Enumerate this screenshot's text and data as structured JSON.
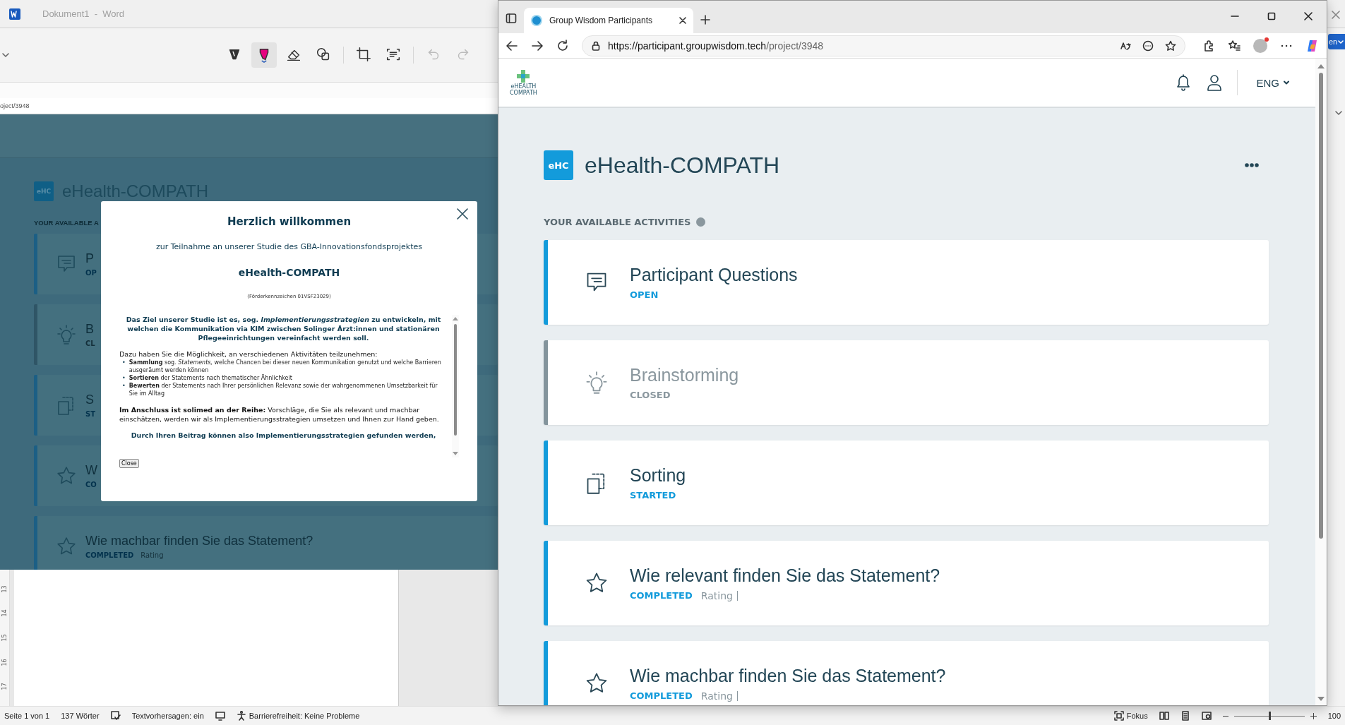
{
  "word": {
    "title": "Dokument1  -  Word",
    "tools": [
      {
        "kind": "pen",
        "selected": false,
        "disabled": false
      },
      {
        "kind": "highlighter",
        "selected": true,
        "disabled": false
      },
      {
        "kind": "eraser",
        "selected": false,
        "disabled": false
      },
      {
        "kind": "shapes",
        "selected": false,
        "disabled": false
      },
      {
        "kind": "crop",
        "selected": false,
        "disabled": false
      },
      {
        "kind": "scan",
        "selected": false,
        "disabled": false
      },
      {
        "kind": "undo",
        "selected": false,
        "disabled": true
      },
      {
        "kind": "redo",
        "selected": false,
        "disabled": true
      }
    ],
    "url_fragment": "oject/3948",
    "ruler": [
      "13",
      "14",
      "15",
      "16",
      "17"
    ]
  },
  "embedded_page": {
    "badge": "eHC",
    "title": "eHealth-COMPATH",
    "section": "YOUR AVAILABLE A",
    "cards": [
      {
        "kind": "questions",
        "title": "P",
        "status": "OP",
        "closed": false
      },
      {
        "kind": "idea",
        "title": "B",
        "status": "CL",
        "closed": true
      },
      {
        "kind": "sorting",
        "title": "S",
        "status": "ST",
        "closed": false
      },
      {
        "kind": "rating",
        "title": "W",
        "status": "CO",
        "closed": false
      },
      {
        "kind": "rating",
        "title": "Wie machbar finden Sie das Statement?",
        "status": "COMPLETED",
        "extra": "Rating",
        "closed": false
      }
    ]
  },
  "dialog": {
    "title": "Herzlich willkommen",
    "subtitle": "zur Teilnahme an unserer Studie des GBA-Innovationsfondsprojektes",
    "project": "eHealth-COMPATH",
    "grant": "(Förderkennzeichen 01VSF23029)",
    "goal": "Das Ziel unserer Studie ist es, sog. *Implementierungsstrategien* zu entwickeln, mit welchen die Kommunikation via KIM zwischen Solinger Ärzt:innen und stationären Pflegeeinrichtungen vereinfacht werden soll.",
    "intro": "Dazu haben Sie die Möglichkeit, an verschiedenen Aktivitäten teilzunehmen:",
    "bullet": "•",
    "activities": [
      "**Sammlung** sog. *Statements,* welche Chancen bei dieser neuen Kommunikation genutzt und welche Barrieren ausgeräumt werden können",
      "**Sortieren** der Statements nach thematischer Ähnlichkeit",
      "**Bewerten** der Statements nach Ihrer persönlichen Relevanz sowie der wahrgenommenen Umsetzbarkeit für Sie im Alltag"
    ],
    "next": "**Im Anschluss ist solimed an der Reihe:** Vorschläge, die Sie als relevant und machbar einschätzen, werden wir als Implementierungsstrategien umsetzen und Ihnen zur Hand geben.",
    "closing": "Durch Ihren Beitrag können also Implementierungsstrategien gefunden werden,",
    "close_button": "Close"
  },
  "browser": {
    "tab_title": "Group Wisdom Participants",
    "url_host": "https://participant.groupwisdom.tech",
    "url_path": "/project/3948",
    "logo_lines": [
      "eHEALTH",
      "COMPATH"
    ],
    "language": "ENG",
    "project_badge": "eHC",
    "project_title": "eHealth-COMPATH",
    "section": "YOUR AVAILABLE ACTIVITIES",
    "activities": [
      {
        "kind": "questions",
        "title": "Participant Questions",
        "status": "OPEN",
        "closed": false
      },
      {
        "kind": "idea",
        "title": "Brainstorming",
        "status": "CLOSED",
        "closed": true
      },
      {
        "kind": "sorting",
        "title": "Sorting",
        "status": "STARTED",
        "closed": false
      },
      {
        "kind": "rating",
        "title": "Wie relevant finden Sie das Statement?",
        "status": "COMPLETED",
        "extra": "Rating",
        "closed": false
      },
      {
        "kind": "rating",
        "title": "Wie machbar finden Sie das Statement?",
        "status": "COMPLETED",
        "extra": "Rating",
        "closed": false
      }
    ]
  },
  "other_window": {
    "button": "en"
  },
  "status_bar": {
    "pages": "Seite 1 von 1",
    "words": "137 Wörter",
    "prediction": "Textvorhersagen: ein",
    "accessibility": "Barrierefreiheit: Keine Probleme",
    "focus": "Fokus",
    "zoom": {
      "level": 0.5,
      "text": "100"
    }
  }
}
